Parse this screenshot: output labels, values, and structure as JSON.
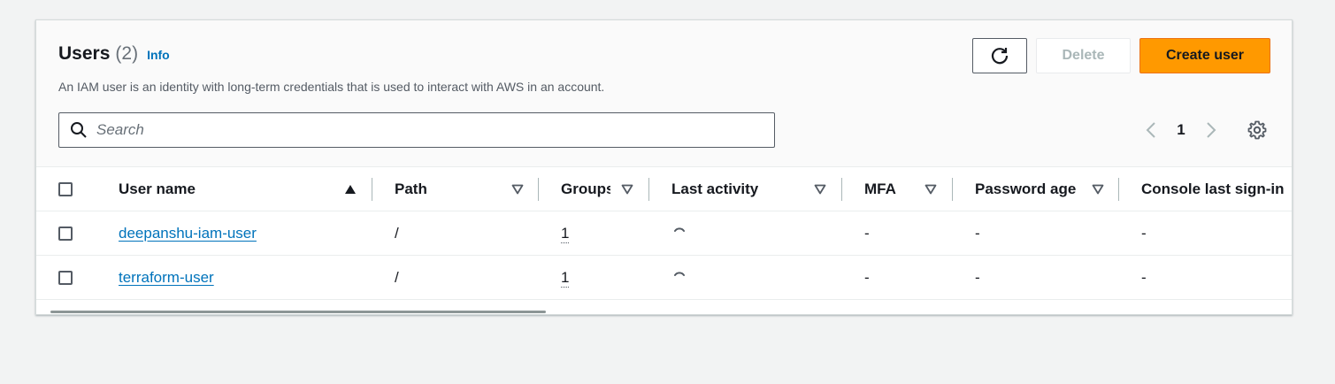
{
  "header": {
    "title": "Users",
    "count": "(2)",
    "info_label": "Info",
    "description": "An IAM user is an identity with long-term credentials that is used to interact with AWS in an account."
  },
  "actions": {
    "refresh_icon": "refresh-icon",
    "delete_label": "Delete",
    "create_label": "Create user",
    "accent_color": "#ff9900"
  },
  "search": {
    "placeholder": "Search",
    "value": ""
  },
  "pagination": {
    "current_page": "1"
  },
  "table": {
    "columns": [
      {
        "label": "User name",
        "sort": "ascending"
      },
      {
        "label": "Path",
        "sort": "none"
      },
      {
        "label": "Groups",
        "sort": "none"
      },
      {
        "label": "Last activity",
        "sort": "none"
      },
      {
        "label": "MFA",
        "sort": "none"
      },
      {
        "label": "Password age",
        "sort": "none"
      },
      {
        "label": "Console last sign-in",
        "sort": "none"
      }
    ],
    "rows": [
      {
        "user_name": "deepanshu-iam-user",
        "path": "/",
        "groups": "1",
        "last_activity": "loading",
        "mfa": "-",
        "password_age": "-",
        "console_last_sign_in": "-"
      },
      {
        "user_name": "terraform-user",
        "path": "/",
        "groups": "1",
        "last_activity": "loading",
        "mfa": "-",
        "password_age": "-",
        "console_last_sign_in": "-"
      }
    ]
  }
}
